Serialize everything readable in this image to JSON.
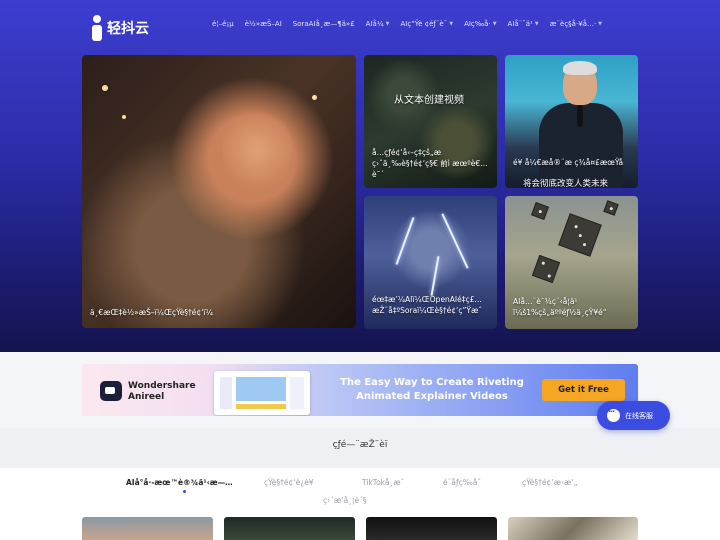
{
  "brand": {
    "logo_text": "轻抖云"
  },
  "nav": {
    "items": [
      {
        "label": "é¦–é¡µ",
        "has_caret": false
      },
      {
        "label": "è½»æŠ–AI",
        "has_caret": false
      },
      {
        "label": "SoraAIå¸æ—¶ä»£",
        "has_caret": false
      },
      {
        "label": "AIå¼",
        "has_caret": true
      },
      {
        "label": "AIç”Ÿè ¢éƒ¨è¯",
        "has_caret": true
      },
      {
        "label": "AIç‰å·",
        "has_caret": true
      },
      {
        "label": "AIå¨¯ä¹",
        "has_caret": true
      },
      {
        "label": "æ¨èç§å·¥å…·",
        "has_caret": true
      }
    ]
  },
  "hero": {
    "main_caption": "ä¸€æŒ‡è½»æŠ–ï¼ŒçŸ­è§†é¢‘ï¼",
    "top1_caption": "å…­çƒé¢‘å‹–ç‡çš„æ ç›ˆä¸‰è§†é¢‘ç§€ 前ì æœºè€…è¯´",
    "top1_overlay": "从文本创建视频",
    "top2_caption": "é¥ å¼€æ­å®¨æ ç­¾å¤£æœŸå",
    "top2_caption2": "将会彻底改变人类未来",
    "bottom1_caption": "éœ‡æ’¼AIï¼ŒOpenAIé‡ç£…æŽ¨å‡ºSoraï¼Œè§†é¢‘ç”Ÿæˆ",
    "bottom2_caption": "AIå…¨è¯¾ç¨‹å­¦ä¹ ï¼š1%çš„äººéƒ½ä¸çŸ¥é“"
  },
  "banner": {
    "brand_line1": "Wondershare",
    "brand_line2": "Anireel",
    "headline": "The Easy Way to Create Riveting Animated Explainer Videos",
    "cta": "Get it Free"
  },
  "service": {
    "label": "在线客服"
  },
  "section": {
    "title": "çƒ­é—¨æŽ¨èï",
    "tabs": [
      {
        "label": "AIå°å·-æœ™è®¾ä¹‹æ—…",
        "active": true
      },
      {
        "label": "çŸ­è§†é¢‘è¿è¥",
        "active": false
      },
      {
        "label": "TikTokå¸æˆ",
        "active": false
      },
      {
        "label": "é¨åƒç‰åˆ",
        "active": false
      },
      {
        "label": "çŸ­è§†é¢‘æ‹æ‘„",
        "active": false
      },
      {
        "label": "ç›´æ’­å¸¦è´§",
        "active": false
      }
    ]
  },
  "colors": {
    "hero_top": "#3d3ed0",
    "hero_bottom": "#14144f",
    "accent": "#3a4de0",
    "cta": "#f5a623"
  },
  "icons": [
    "logo-mark-icon",
    "caret-down-icon",
    "chat-bubble-icon",
    "video-logo-icon"
  ]
}
